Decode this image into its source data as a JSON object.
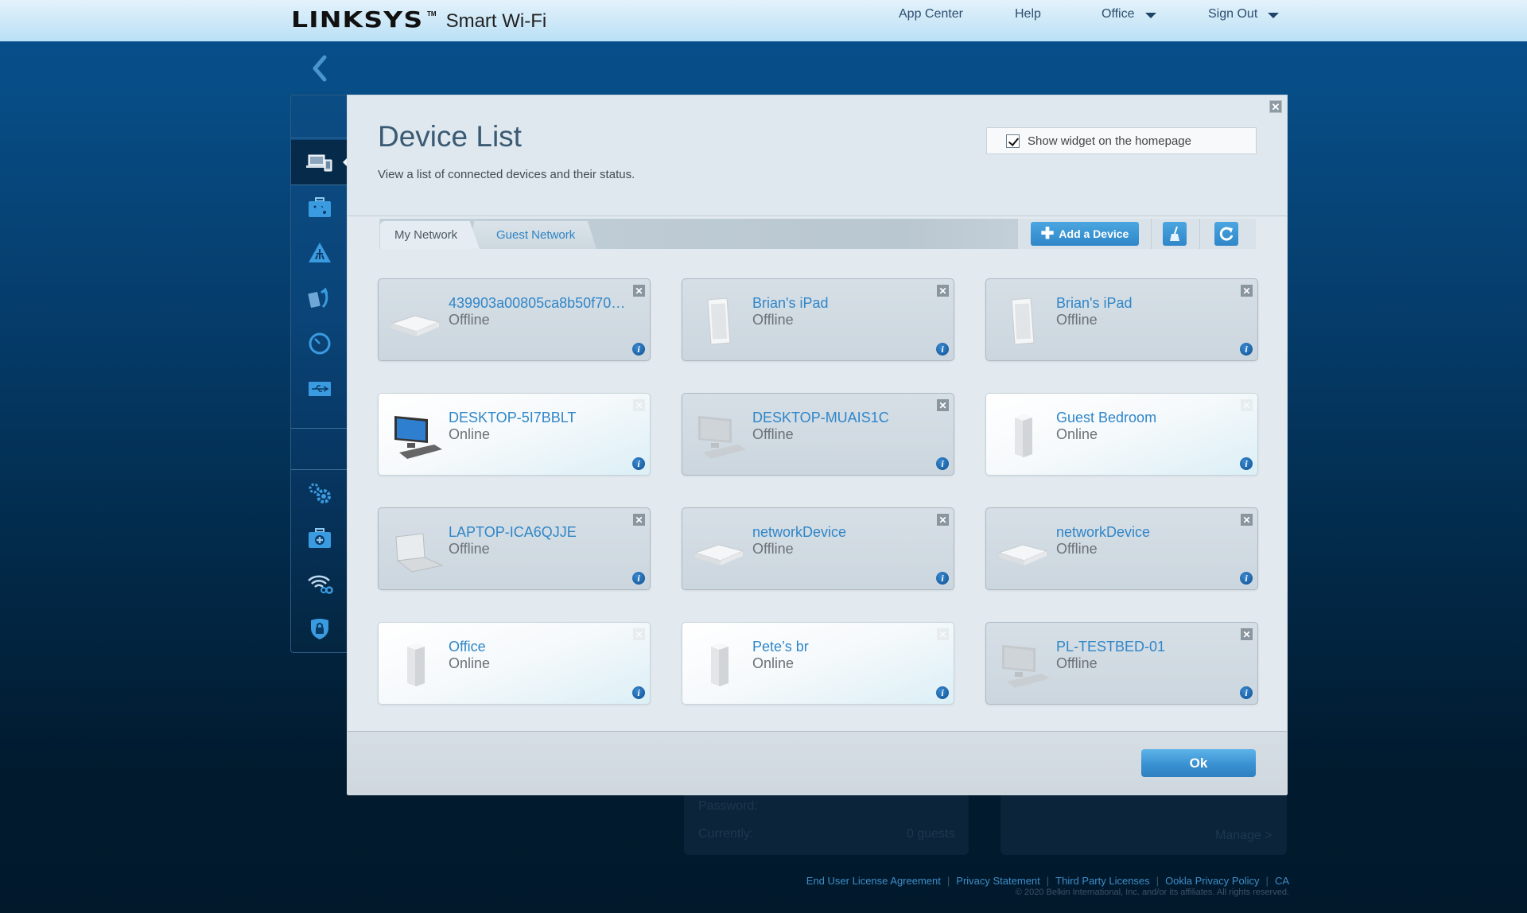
{
  "header": {
    "brand": "LINKSYS",
    "trademark": "TM",
    "product": "Smart Wi-Fi",
    "nav": [
      {
        "label": "App Center",
        "has_dropdown": false
      },
      {
        "label": "Help",
        "has_dropdown": false
      },
      {
        "label": "Office",
        "has_dropdown": true
      },
      {
        "label": "Sign Out",
        "has_dropdown": true
      }
    ]
  },
  "sidebar": {
    "back_icon": "chevron-left-icon",
    "items": [
      {
        "id": "device-list",
        "icon": "devices-icon",
        "active": true
      },
      {
        "id": "guest-access",
        "icon": "suitcase-icon",
        "active": false
      },
      {
        "id": "parental-controls",
        "icon": "parental-warning-icon",
        "active": false
      },
      {
        "id": "media-prioritization",
        "icon": "media-priority-icon",
        "active": false
      },
      {
        "id": "speed-test",
        "icon": "speedometer-icon",
        "active": false
      },
      {
        "id": "external-storage",
        "icon": "usb-icon",
        "active": false
      },
      {
        "id": "connectivity",
        "icon": "gears-icon",
        "active": false
      },
      {
        "id": "troubleshooting",
        "icon": "first-aid-kit-icon",
        "active": false
      },
      {
        "id": "wireless",
        "icon": "wifi-settings-icon",
        "active": false
      },
      {
        "id": "security",
        "icon": "shield-lock-icon",
        "active": false
      }
    ]
  },
  "background_widget": {
    "password_label": "Password:",
    "currently_label": "Currently:",
    "guests_value": "0 guests",
    "manage_link": "Manage >"
  },
  "modal": {
    "title": "Device List",
    "subtitle": "View a list of connected devices and their status.",
    "show_widget_label": "Show widget on the homepage",
    "show_widget_checked": true,
    "close_icon": "close-icon",
    "tabs": [
      {
        "label": "My Network",
        "active": true
      },
      {
        "label": "Guest Network",
        "active": false
      }
    ],
    "add_device_label": "Add a Device",
    "clean_icon": "broom-icon",
    "refresh_icon": "refresh-icon",
    "devices": [
      {
        "name": "439903a00805ca8b50f70…",
        "status": "Offline",
        "type": "network-device"
      },
      {
        "name": "Brian's iPad",
        "status": "Offline",
        "type": "tablet"
      },
      {
        "name": "Brian's iPad",
        "status": "Offline",
        "type": "tablet"
      },
      {
        "name": "DESKTOP-5I7BBLT",
        "status": "Online",
        "type": "desktop"
      },
      {
        "name": "DESKTOP-MUAIS1C",
        "status": "Offline",
        "type": "desktop"
      },
      {
        "name": "Guest Bedroom",
        "status": "Online",
        "type": "node"
      },
      {
        "name": "LAPTOP-ICA6QJJE",
        "status": "Offline",
        "type": "laptop"
      },
      {
        "name": "networkDevice",
        "status": "Offline",
        "type": "network-device"
      },
      {
        "name": "networkDevice",
        "status": "Offline",
        "type": "network-device"
      },
      {
        "name": "Office",
        "status": "Online",
        "type": "node"
      },
      {
        "name": "Pete’s br",
        "status": "Online",
        "type": "node"
      },
      {
        "name": "PL-TESTBED-01",
        "status": "Offline",
        "type": "desktop"
      }
    ],
    "ok_label": "Ok"
  },
  "footer": {
    "links": [
      "End User License Agreement",
      "Privacy Statement",
      "Third Party Licenses",
      "Ookla Privacy Policy",
      "CA"
    ],
    "copyright": "© 2020 Belkin International, Inc. and/or its affiliates. All rights reserved."
  },
  "colors": {
    "accent": "#2f86c8",
    "header_bg": "#cfe9f8",
    "page_bg": "#053c6a",
    "offline_card": "#d0d9e0",
    "online_card": "#f5f9fb"
  }
}
